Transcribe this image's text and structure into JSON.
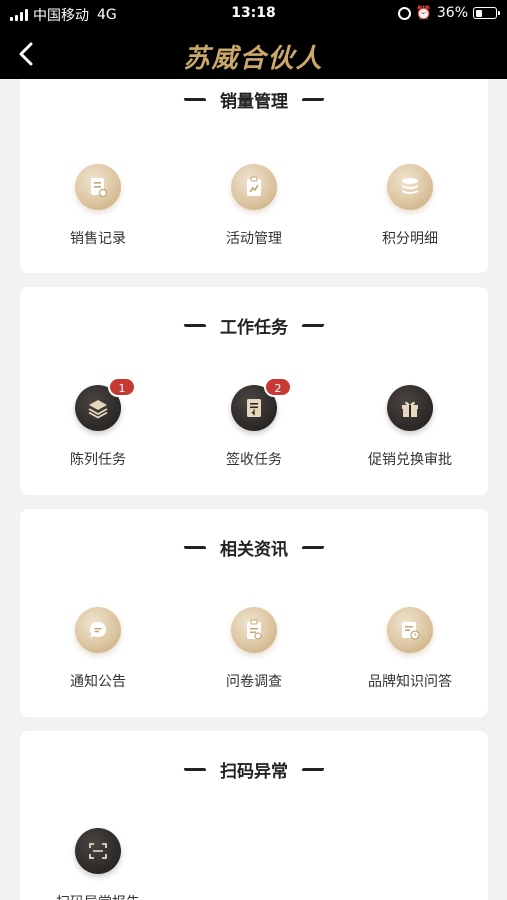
{
  "status_bar": {
    "carrier": "中国移动",
    "network": "4G",
    "time": "13:18",
    "battery": "36%"
  },
  "nav": {
    "title": "苏威合伙人"
  },
  "sections": [
    {
      "title": "销量管理",
      "items": [
        {
          "label": "销售记录",
          "icon": "document-icon",
          "style": "gold"
        },
        {
          "label": "活动管理",
          "icon": "clipboard-chart-icon",
          "style": "gold"
        },
        {
          "label": "积分明细",
          "icon": "coins-stack-icon",
          "style": "gold"
        }
      ]
    },
    {
      "title": "工作任务",
      "items": [
        {
          "label": "陈列任务",
          "icon": "layers-icon",
          "style": "dark",
          "badge": "1"
        },
        {
          "label": "签收任务",
          "icon": "receipt-icon",
          "style": "dark",
          "badge": "2"
        },
        {
          "label": "促销兑换审批",
          "icon": "gift-icon",
          "style": "dark"
        }
      ]
    },
    {
      "title": "相关资讯",
      "items": [
        {
          "label": "通知公告",
          "icon": "chat-bubble-icon",
          "style": "gold"
        },
        {
          "label": "问卷调查",
          "icon": "survey-icon",
          "style": "gold"
        },
        {
          "label": "品牌知识问答",
          "icon": "qa-document-icon",
          "style": "gold"
        }
      ]
    },
    {
      "title": "扫码异常",
      "items": [
        {
          "label": "扫码异常报告",
          "icon": "scan-icon",
          "style": "dark"
        }
      ]
    }
  ],
  "colors": {
    "gold": "#c9a86a",
    "badge": "#c73a33",
    "dark_icon": "#2b2725"
  }
}
